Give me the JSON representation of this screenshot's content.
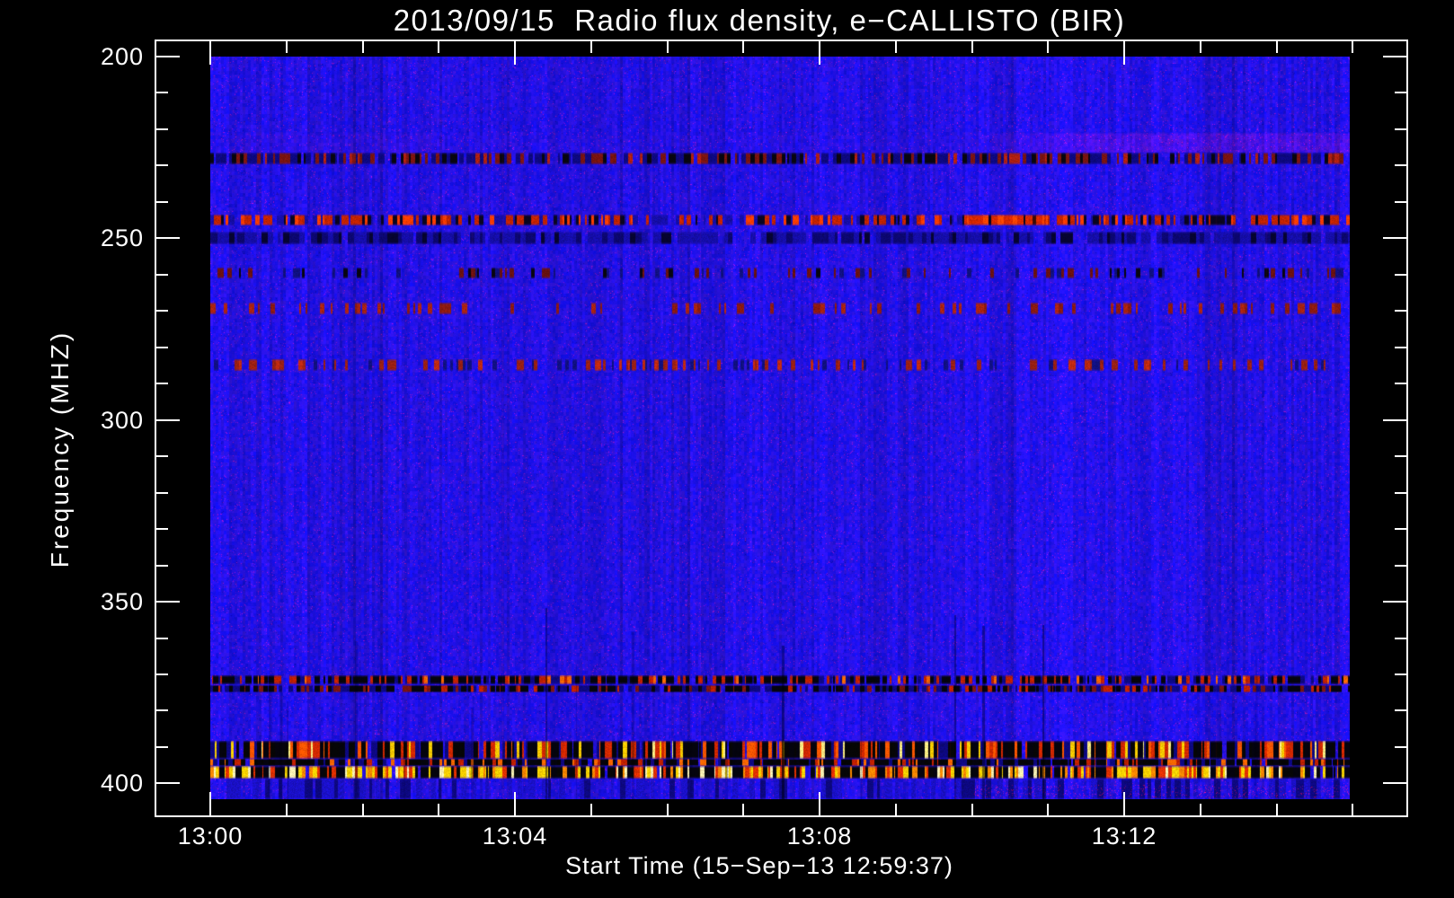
{
  "chart_data": {
    "type": "heatmap",
    "title": "2013/09/15  Radio flux density, e−CALLISTO (BIR)",
    "xlabel": "Start Time (15−Sep−13 12:59:37)",
    "ylabel": "Frequency (MHZ)",
    "date": "2013/09/15",
    "instrument": "e−CALLISTO",
    "station_code": "BIR",
    "start_time": "15−Sep−13 12:59:37",
    "x_range_time": [
      "13:00",
      "13:15"
    ],
    "ylim_mhz": [
      200,
      404
    ],
    "grid": false,
    "legend": "none",
    "background_color": "#1a0ee8",
    "frame_color": "#ffffff",
    "text_color": "#ffffff",
    "colormap": [
      "#000000",
      "#0d0880",
      "#1a0ee8",
      "#c22300",
      "#ff5500",
      "#ffd300",
      "#fff2b0"
    ],
    "x_axis": {
      "title": "Start Time (15−Sep−13 12:59:37)",
      "major": [
        {
          "label": "13:00",
          "min": 0
        },
        {
          "label": "13:04",
          "min": 4
        },
        {
          "label": "13:08",
          "min": 8
        },
        {
          "label": "13:12",
          "min": 12
        }
      ],
      "minor_min": [
        1,
        2,
        3,
        5,
        6,
        7,
        9,
        10,
        11,
        13,
        14,
        15
      ]
    },
    "y_axis": {
      "title": "Frequency (MHZ)",
      "major": [
        {
          "label": "200",
          "mhz": 200
        },
        {
          "label": "250",
          "mhz": 250
        },
        {
          "label": "300",
          "mhz": 300
        },
        {
          "label": "350",
          "mhz": 350
        },
        {
          "label": "400",
          "mhz": 400
        }
      ],
      "minor_mhz": [
        210,
        220,
        230,
        240,
        260,
        270,
        280,
        290,
        310,
        320,
        330,
        340,
        360,
        370,
        380,
        390
      ]
    },
    "bands": [
      {
        "name": "haze-221-226",
        "mhz": [
          221.0,
          226.4
        ],
        "style": "haze",
        "color": "#8a1c10",
        "note": "faint reddish interference haze, strongest right of 13:08"
      },
      {
        "name": "rfi-227-230",
        "mhz": [
          226.4,
          229.7
        ],
        "style": "speckle",
        "bg": 0.2,
        "run": [
          2,
          5
        ],
        "colors": [
          [
            "#0d0880",
            0.3
          ],
          [
            "#7a1410",
            0.22
          ],
          [
            "#08060f",
            0.18
          ],
          [
            "#b02010",
            0.1
          ]
        ]
      },
      {
        "name": "rfi-245",
        "mhz": [
          243.5,
          246.5
        ],
        "style": "speckle",
        "bg": 0.25,
        "run": [
          2,
          5
        ],
        "colors": [
          [
            "#c22300",
            0.28
          ],
          [
            "#ff3c00",
            0.12
          ],
          [
            "#0a0520",
            0.18
          ],
          [
            "#150da8",
            0.17
          ]
        ],
        "hot_segment": {
          "minutes": [
            9.9,
            11.0
          ],
          "bg": 0.05,
          "colors": [
            [
              "#d82800",
              0.55
            ],
            [
              "#ff4400",
              0.22
            ],
            [
              "#3a0a06",
              0.1
            ],
            [
              "#0a0520",
              0.08
            ]
          ],
          "note": "near-continuous red RFI burst ~13:10"
        }
      },
      {
        "name": "dark-248-252",
        "mhz": [
          248.2,
          251.6
        ],
        "style": "speckle",
        "bg": 0.15,
        "run": [
          3,
          7
        ],
        "colors": [
          [
            "#150da8",
            0.45
          ],
          [
            "#0c0770",
            0.28
          ],
          [
            "#060430",
            0.12
          ]
        ]
      },
      {
        "name": "faint-258-261",
        "mhz": [
          258.0,
          261.0
        ],
        "style": "speckle",
        "bg": 0.72,
        "run": [
          2,
          5
        ],
        "colors": [
          [
            "#101080",
            0.1
          ],
          [
            "#6a1210",
            0.1
          ],
          [
            "#08060f",
            0.08
          ]
        ]
      },
      {
        "name": "faint-268-271",
        "mhz": [
          267.7,
          270.9
        ],
        "style": "speckle",
        "bg": 0.8,
        "run": [
          2,
          5
        ],
        "colors": [
          [
            "#8a1a10",
            0.12
          ],
          [
            "#aa2410",
            0.08
          ]
        ]
      },
      {
        "name": "faint-283-286",
        "mhz": [
          283.3,
          286.5
        ],
        "style": "speckle",
        "bg": 0.66,
        "run": [
          2,
          5
        ],
        "colors": [
          [
            "#9a2012",
            0.16
          ],
          [
            "#c02a10",
            0.08
          ],
          [
            "#101080",
            0.1
          ]
        ]
      },
      {
        "name": "rfi-370-373",
        "mhz": [
          370.2,
          372.7
        ],
        "style": "speckle",
        "group": "B",
        "bg": 0.22,
        "run": [
          2,
          5
        ],
        "colors": [
          [
            "#06050a",
            0.25
          ],
          [
            "#c02000",
            0.25
          ],
          [
            "#ff6600",
            0.08
          ],
          [
            "#0d0880",
            0.2
          ]
        ]
      },
      {
        "name": "rfi-373-375",
        "mhz": [
          373.0,
          375.0
        ],
        "style": "speckle",
        "group": "B",
        "bg": 0.18,
        "run": [
          2,
          5
        ],
        "colors": [
          [
            "#0d0880",
            0.34
          ],
          [
            "#7a1410",
            0.2
          ],
          [
            "#c02000",
            0.12
          ],
          [
            "#06050a",
            0.16
          ]
        ]
      },
      {
        "name": "rfi-388-393",
        "mhz": [
          388.3,
          393.2
        ],
        "style": "speckle",
        "group": "C",
        "bg": 0.06,
        "run": [
          2,
          5
        ],
        "colors": [
          [
            "#060606",
            0.3
          ],
          [
            "#d22800",
            0.22
          ],
          [
            "#ff5500",
            0.14
          ],
          [
            "#ffcc00",
            0.09
          ],
          [
            "#ffe880",
            0.05
          ],
          [
            "#0d0880",
            0.14
          ]
        ]
      },
      {
        "name": "rfi-393-395",
        "mhz": [
          393.2,
          395.2
        ],
        "style": "speckle",
        "group": "C",
        "bg": 0.08,
        "run": [
          2,
          5
        ],
        "colors": [
          [
            "#050505",
            0.44
          ],
          [
            "#c02000",
            0.18
          ],
          [
            "#0d0880",
            0.18
          ],
          [
            "#ff6600",
            0.12
          ]
        ]
      },
      {
        "name": "rfi-395-399",
        "mhz": [
          395.2,
          398.7
        ],
        "style": "speckle",
        "group": "C",
        "bg": 0.05,
        "run": [
          2,
          4
        ],
        "colors": [
          [
            "#070707",
            0.22
          ],
          [
            "#ffd300",
            0.24
          ],
          [
            "#fff2b0",
            0.13
          ],
          [
            "#ff8800",
            0.2
          ],
          [
            "#e03000",
            0.16
          ]
        ]
      },
      {
        "name": "streaky-399-404",
        "mhz": [
          398.7,
          404.3
        ],
        "style": "speckle",
        "bg": 0.58,
        "run": [
          3,
          7
        ],
        "colors": [
          [
            "#0d0880",
            0.18
          ],
          [
            "#1a10c8",
            0.24
          ]
        ]
      }
    ],
    "artifacts": {
      "dark_time_streaks_min": [
        4.4,
        7.5,
        9.77,
        10.14,
        10.93
      ],
      "random_dark_streaks": 16,
      "red_tint_columns": 9,
      "note": "vertical dark dropout lines in lower half; faint red speckle noise over whole image"
    }
  }
}
